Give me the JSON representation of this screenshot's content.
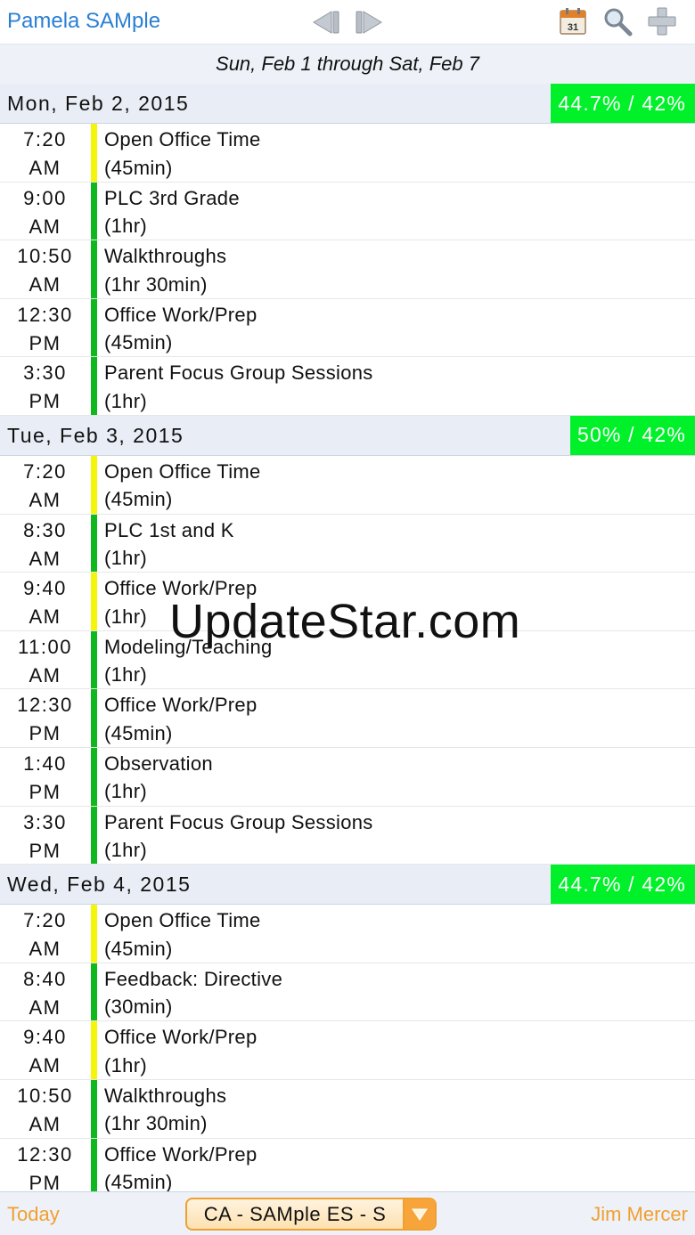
{
  "header": {
    "user_name": "Pamela SAMple",
    "icons": [
      "prev-arrow-icon",
      "next-arrow-icon",
      "calendar-icon",
      "search-icon",
      "add-icon"
    ],
    "calendar_day": "31"
  },
  "range": {
    "text": "Sun, Feb 1 through Sat, Feb 7"
  },
  "colors": {
    "green": "#00f02a",
    "bar_green": "#10b820",
    "bar_yellow": "#f5f50a",
    "accent_blue": "#2a7fd4",
    "accent_orange": "#f0a030"
  },
  "days": [
    {
      "label": "Mon, Feb 2, 2015",
      "pct": "44.7% / 42%",
      "events": [
        {
          "time_1": "7:20",
          "time_2": "AM",
          "title": "Open Office Time",
          "duration": "(45min)",
          "bar": "yellow"
        },
        {
          "time_1": "9:00",
          "time_2": "AM",
          "title": "PLC 3rd Grade",
          "duration": "(1hr)",
          "bar": "green"
        },
        {
          "time_1": "10:50",
          "time_2": "AM",
          "title": "Walkthroughs",
          "duration": "(1hr 30min)",
          "bar": "green"
        },
        {
          "time_1": "12:30",
          "time_2": "PM",
          "title": "Office Work/Prep",
          "duration": "(45min)",
          "bar": "green"
        },
        {
          "time_1": "3:30",
          "time_2": "PM",
          "title": "Parent Focus Group Sessions",
          "duration": "(1hr)",
          "bar": "green"
        }
      ]
    },
    {
      "label": "Tue, Feb 3, 2015",
      "pct": "50% / 42%",
      "events": [
        {
          "time_1": "7:20",
          "time_2": "AM",
          "title": "Open Office Time",
          "duration": "(45min)",
          "bar": "yellow"
        },
        {
          "time_1": "8:30",
          "time_2": "AM",
          "title": "PLC 1st and K",
          "duration": "(1hr)",
          "bar": "green"
        },
        {
          "time_1": "9:40",
          "time_2": "AM",
          "title": "Office Work/Prep",
          "duration": "(1hr)",
          "bar": "yellow"
        },
        {
          "time_1": "11:00",
          "time_2": "AM",
          "title": "Modeling/Teaching",
          "duration": "(1hr)",
          "bar": "green"
        },
        {
          "time_1": "12:30",
          "time_2": "PM",
          "title": "Office Work/Prep",
          "duration": "(45min)",
          "bar": "green"
        },
        {
          "time_1": "1:40",
          "time_2": "PM",
          "title": "Observation",
          "duration": "(1hr)",
          "bar": "green"
        },
        {
          "time_1": "3:30",
          "time_2": "PM",
          "title": "Parent Focus Group Sessions",
          "duration": "(1hr)",
          "bar": "green"
        }
      ]
    },
    {
      "label": "Wed, Feb 4, 2015",
      "pct": "44.7% / 42%",
      "events": [
        {
          "time_1": "7:20",
          "time_2": "AM",
          "title": "Open Office Time",
          "duration": "(45min)",
          "bar": "yellow"
        },
        {
          "time_1": "8:40",
          "time_2": "AM",
          "title": "Feedback: Directive",
          "duration": "(30min)",
          "bar": "green"
        },
        {
          "time_1": "9:40",
          "time_2": "AM",
          "title": "Office Work/Prep",
          "duration": "(1hr)",
          "bar": "yellow"
        },
        {
          "time_1": "10:50",
          "time_2": "AM",
          "title": "Walkthroughs",
          "duration": "(1hr 30min)",
          "bar": "green"
        },
        {
          "time_1": "12:30",
          "time_2": "PM",
          "title": "Office Work/Prep",
          "duration": "(45min)",
          "bar": "green"
        }
      ]
    }
  ],
  "footer": {
    "today_label": "Today",
    "selector_value": "CA - SAMple ES - S",
    "user_label": "Jim Mercer"
  },
  "watermark": "UpdateStar.com"
}
